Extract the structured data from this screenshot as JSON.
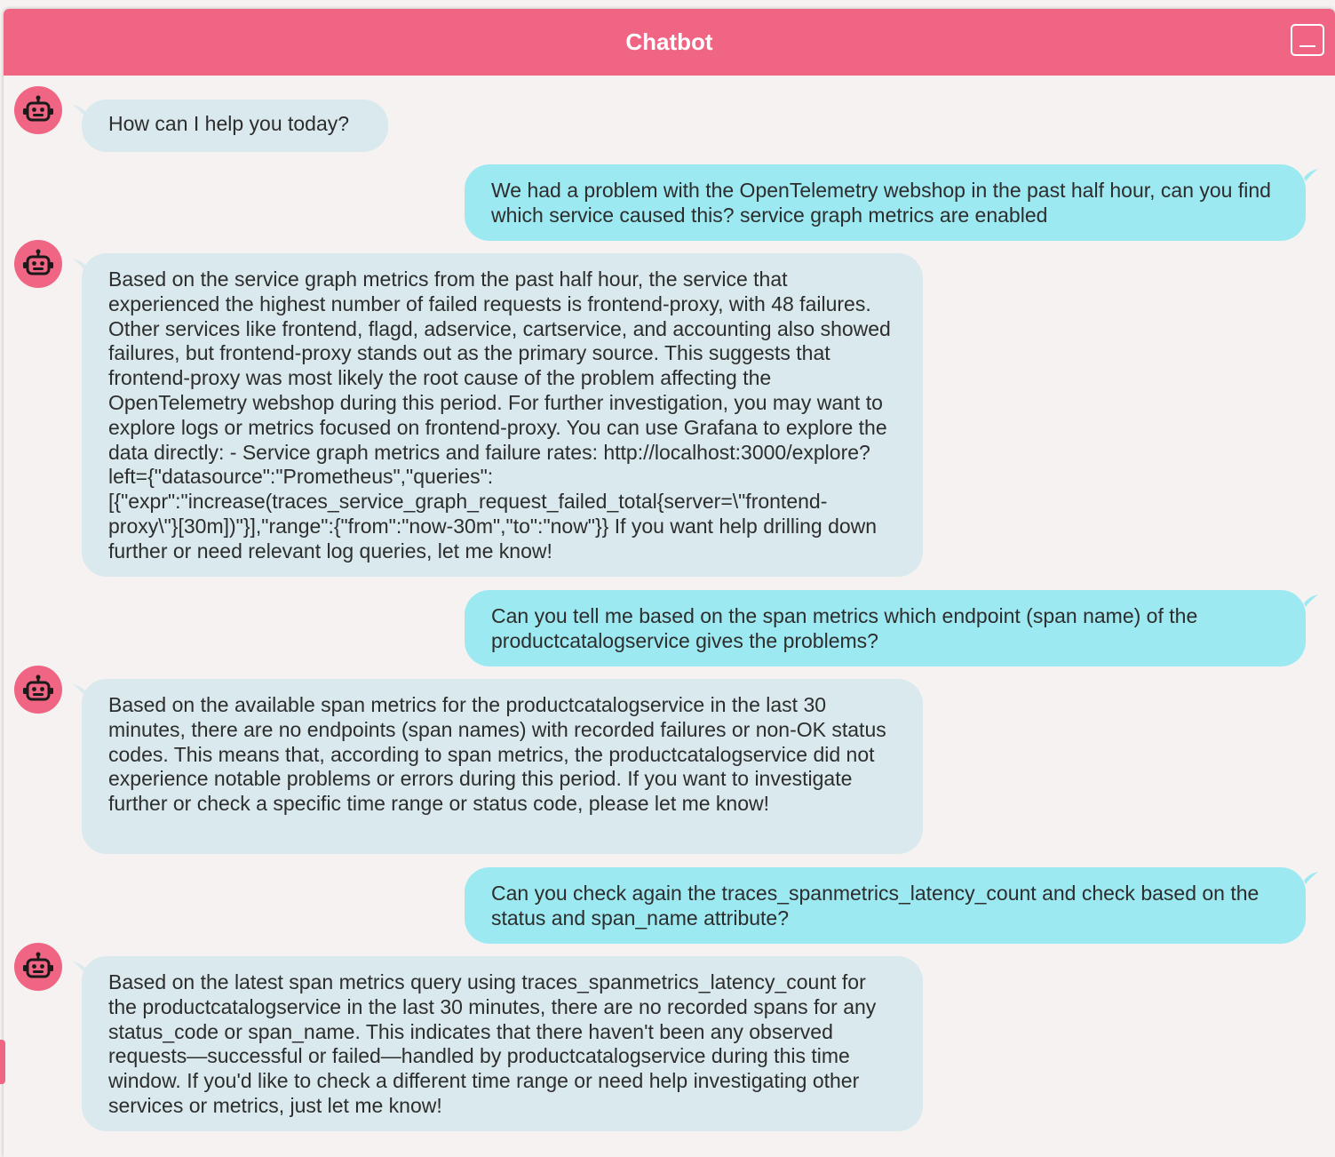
{
  "header": {
    "title": "Chatbot"
  },
  "colors": {
    "header": "#ef6583",
    "avatar": "#ef6583",
    "bot_bubble": "#d9e9ed",
    "user_bubble": "#9de9f1",
    "background": "#f6f2f1"
  },
  "icons": {
    "minimize": "minimize-icon",
    "bot_avatar": "robot-icon"
  },
  "messages": [
    {
      "sender": "bot",
      "text": "How can I help you today?"
    },
    {
      "sender": "user",
      "text": "We had a problem with the OpenTelemetry webshop in the past half hour, can you find which service caused this? service graph metrics are enabled"
    },
    {
      "sender": "bot",
      "text": "Based on the service graph metrics from the past half hour, the service that experienced the highest number of failed requests is frontend-proxy, with 48 failures. Other services like frontend, flagd, adservice, cartservice, and accounting also showed failures, but frontend-proxy stands out as the primary source. This suggests that frontend-proxy was most likely the root cause of the problem affecting the OpenTelemetry webshop during this period. For further investigation, you may want to explore logs or metrics focused on frontend-proxy. You can use Grafana to explore the data directly: - Service graph metrics and failure rates: http://localhost:3000/explore?left={\"datasource\":\"Prometheus\",\"queries\":[{\"expr\":\"increase(traces_service_graph_request_failed_total{server=\\\"frontend-proxy\\\"}[30m])\"}],\"range\":{\"from\":\"now-30m\",\"to\":\"now\"}} If you want help drilling down further or need relevant log queries, let me know!"
    },
    {
      "sender": "user",
      "text": "Can you tell me based on the span metrics which endpoint (span name) of the productcatalogservice gives the problems?"
    },
    {
      "sender": "bot",
      "text": "Based on the available span metrics for the productcatalogservice in the last 30 minutes, there are no endpoints (span names) with recorded failures or non-OK status codes. This means that, according to span metrics, the productcatalogservice did not experience notable problems or errors during this period. If you want to investigate further or check a specific time range or status code, please let me know!"
    },
    {
      "sender": "user",
      "text": "Can you check again the traces_spanmetrics_latency_count and check based on the status and span_name attribute?"
    },
    {
      "sender": "bot",
      "text": "Based on the latest span metrics query using traces_spanmetrics_latency_count for the productcatalogservice in the last 30 minutes, there are no recorded spans for any status_code or span_name. This indicates that there haven't been any observed requests—successful or failed—handled by productcatalogservice during this time window. If you'd like to check a different time range or need help investigating other services or metrics, just let me know!"
    }
  ]
}
